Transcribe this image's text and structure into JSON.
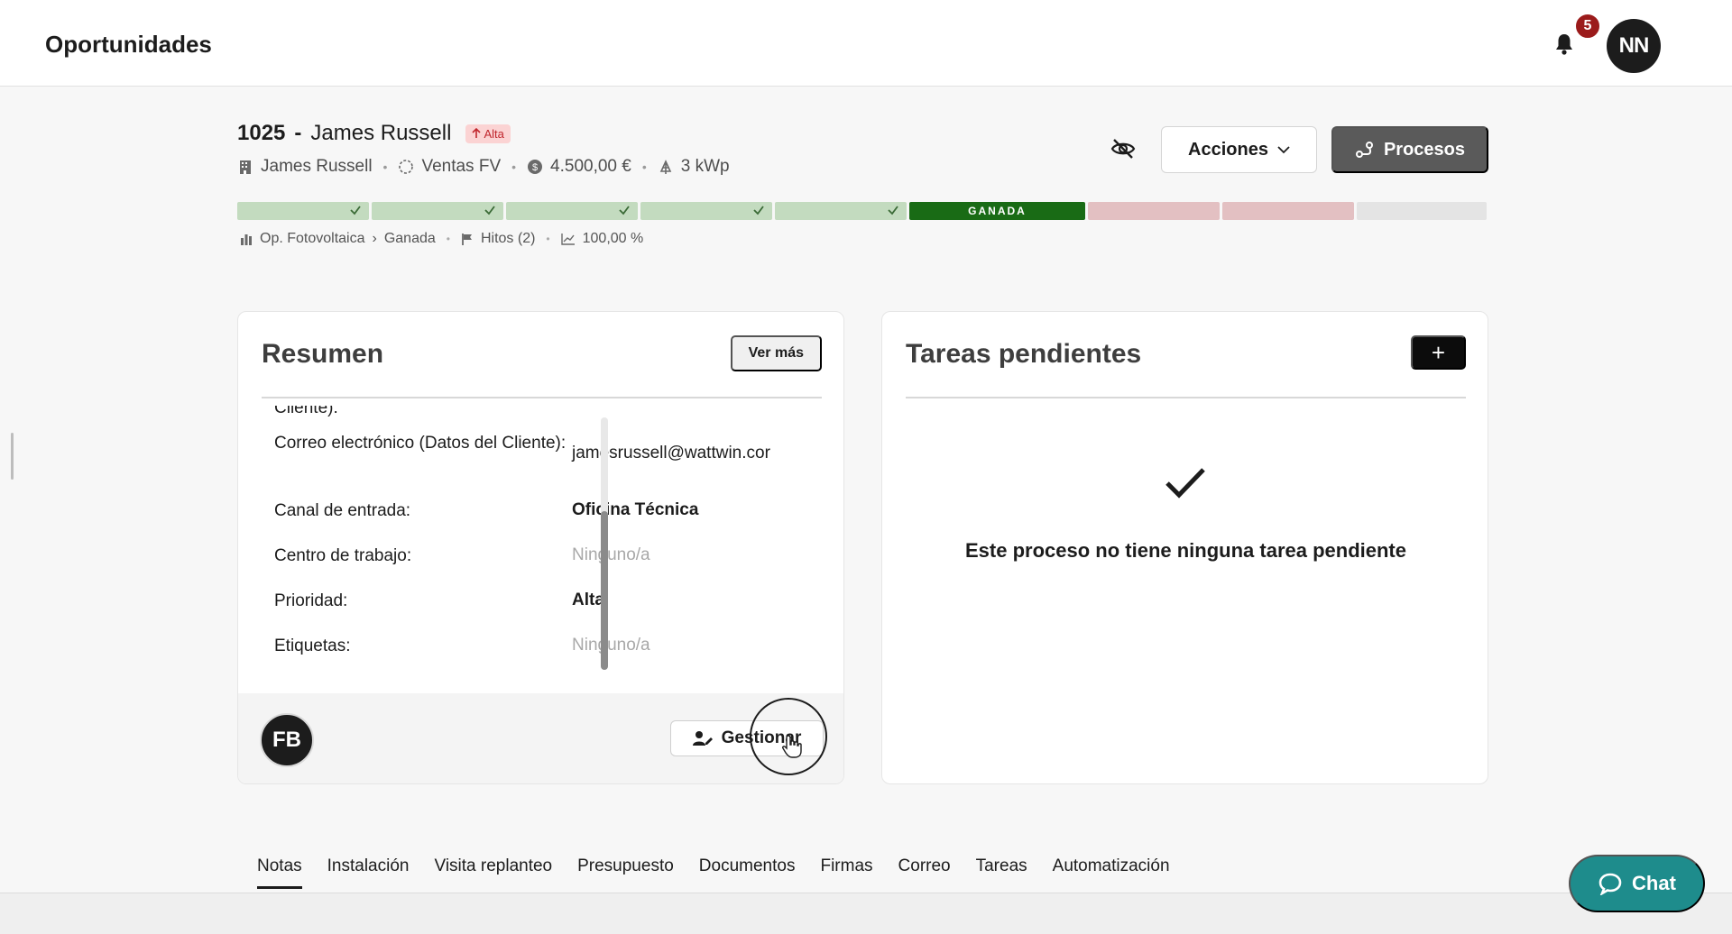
{
  "topbar": {
    "title": "Oportunidades",
    "notification_count": "5",
    "user_initials": "NN"
  },
  "opportunity": {
    "number": "1025",
    "dash": "-",
    "name": "James Russell",
    "priority_badge": "Alta",
    "client": "James Russell",
    "pipeline": "Ventas FV",
    "amount": "4.500,00 €",
    "power": "3 kWp"
  },
  "actions": {
    "acciones_label": "Acciones",
    "procesos_label": "Procesos"
  },
  "progress": {
    "won_label": "GANADA",
    "completed_steps": 5,
    "lost_steps": 2,
    "empty_steps": 1
  },
  "path": {
    "process": "Op. Fotovoltaica",
    "stage": "Ganada",
    "milestones": "Hitos (2)",
    "percent": "100,00 %"
  },
  "resumen": {
    "title": "Resumen",
    "ver_mas": "Ver más",
    "cut_label": "Cliente):",
    "fields": [
      {
        "label": "Correo electrónico (Datos del Cliente):",
        "value": "jamesrussell@wattwin.cor"
      },
      {
        "label": "Canal de entrada:",
        "value": "Oficina Técnica"
      },
      {
        "label": "Centro de trabajo:",
        "value": "Ninguno/a"
      },
      {
        "label": "Prioridad:",
        "value": "Alta"
      },
      {
        "label": "Etiquetas:",
        "value": "Ninguno/a"
      }
    ],
    "owner_initials": "FB",
    "gestionar_label": "Gestionar"
  },
  "tareas": {
    "title": "Tareas pendientes",
    "add_label": "+",
    "empty_message": "Este proceso no tiene ninguna tarea pendiente"
  },
  "tabs": [
    "Notas",
    "Instalación",
    "Visita replanteo",
    "Presupuesto",
    "Documentos",
    "Firmas",
    "Correo",
    "Tareas",
    "Automatización"
  ],
  "chat": {
    "label": "Chat"
  },
  "colors": {
    "won": "#196b15",
    "done": "#c3dbbf",
    "lost": "#e3c0c2",
    "chat": "#1e8c8c",
    "badge_alert": "#9b1b1b"
  }
}
